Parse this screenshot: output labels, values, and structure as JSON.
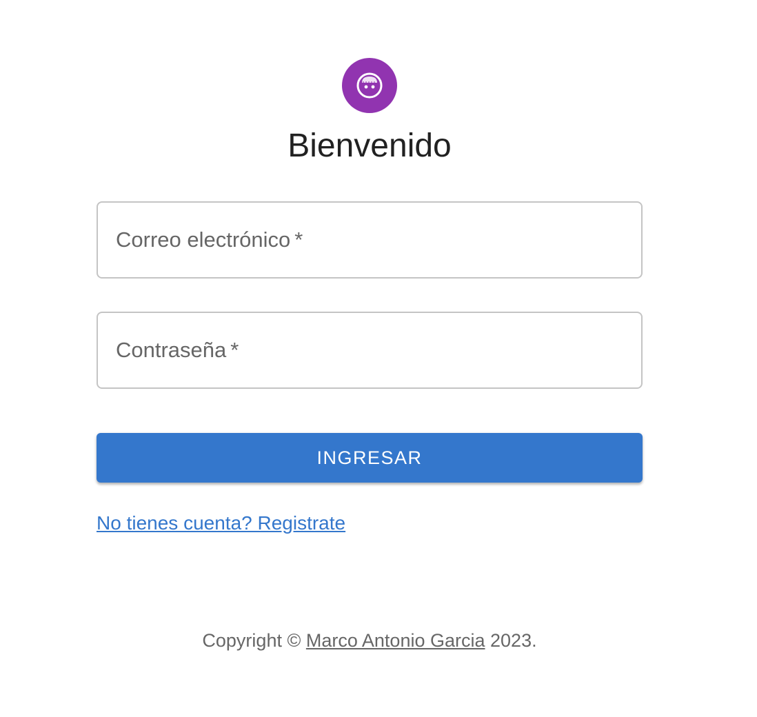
{
  "header": {
    "avatar_icon": "user-face-icon",
    "avatar_color": "#9134b0",
    "title": "Bienvenido"
  },
  "form": {
    "email_label": "Correo electrónico",
    "email_value": "",
    "password_label": "Contraseña",
    "password_value": "",
    "required_marker": "*",
    "submit_label": "INGRESAR",
    "submit_color": "#3477cc",
    "register_link": "No tienes cuenta? Registrate"
  },
  "footer": {
    "copyright_prefix": "Copyright ©",
    "author_link": "Marco Antonio Garcia",
    "year_suffix": "2023."
  }
}
